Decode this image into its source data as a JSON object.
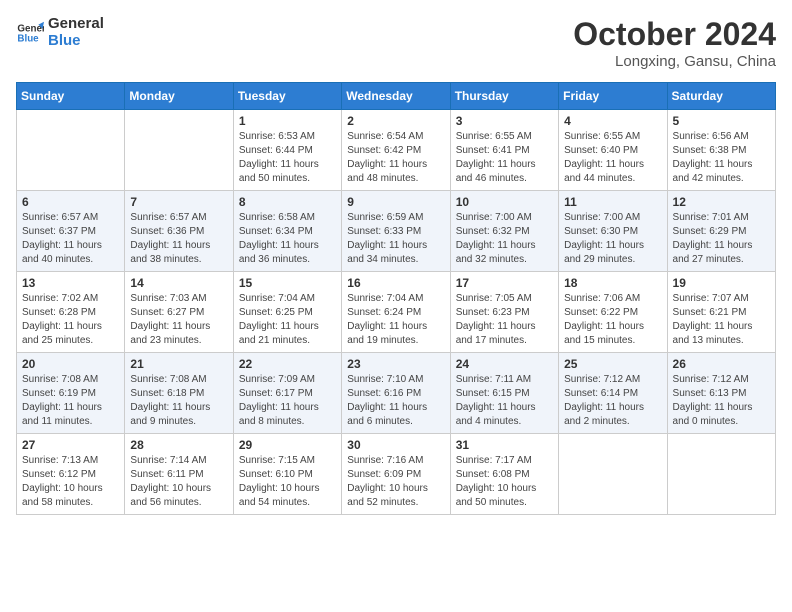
{
  "logo": {
    "line1": "General",
    "line2": "Blue"
  },
  "title": "October 2024",
  "location": "Longxing, Gansu, China",
  "days_header": [
    "Sunday",
    "Monday",
    "Tuesday",
    "Wednesday",
    "Thursday",
    "Friday",
    "Saturday"
  ],
  "weeks": [
    [
      {
        "day": "",
        "info": ""
      },
      {
        "day": "",
        "info": ""
      },
      {
        "day": "1",
        "info": "Sunrise: 6:53 AM\nSunset: 6:44 PM\nDaylight: 11 hours and 50 minutes."
      },
      {
        "day": "2",
        "info": "Sunrise: 6:54 AM\nSunset: 6:42 PM\nDaylight: 11 hours and 48 minutes."
      },
      {
        "day": "3",
        "info": "Sunrise: 6:55 AM\nSunset: 6:41 PM\nDaylight: 11 hours and 46 minutes."
      },
      {
        "day": "4",
        "info": "Sunrise: 6:55 AM\nSunset: 6:40 PM\nDaylight: 11 hours and 44 minutes."
      },
      {
        "day": "5",
        "info": "Sunrise: 6:56 AM\nSunset: 6:38 PM\nDaylight: 11 hours and 42 minutes."
      }
    ],
    [
      {
        "day": "6",
        "info": "Sunrise: 6:57 AM\nSunset: 6:37 PM\nDaylight: 11 hours and 40 minutes."
      },
      {
        "day": "7",
        "info": "Sunrise: 6:57 AM\nSunset: 6:36 PM\nDaylight: 11 hours and 38 minutes."
      },
      {
        "day": "8",
        "info": "Sunrise: 6:58 AM\nSunset: 6:34 PM\nDaylight: 11 hours and 36 minutes."
      },
      {
        "day": "9",
        "info": "Sunrise: 6:59 AM\nSunset: 6:33 PM\nDaylight: 11 hours and 34 minutes."
      },
      {
        "day": "10",
        "info": "Sunrise: 7:00 AM\nSunset: 6:32 PM\nDaylight: 11 hours and 32 minutes."
      },
      {
        "day": "11",
        "info": "Sunrise: 7:00 AM\nSunset: 6:30 PM\nDaylight: 11 hours and 29 minutes."
      },
      {
        "day": "12",
        "info": "Sunrise: 7:01 AM\nSunset: 6:29 PM\nDaylight: 11 hours and 27 minutes."
      }
    ],
    [
      {
        "day": "13",
        "info": "Sunrise: 7:02 AM\nSunset: 6:28 PM\nDaylight: 11 hours and 25 minutes."
      },
      {
        "day": "14",
        "info": "Sunrise: 7:03 AM\nSunset: 6:27 PM\nDaylight: 11 hours and 23 minutes."
      },
      {
        "day": "15",
        "info": "Sunrise: 7:04 AM\nSunset: 6:25 PM\nDaylight: 11 hours and 21 minutes."
      },
      {
        "day": "16",
        "info": "Sunrise: 7:04 AM\nSunset: 6:24 PM\nDaylight: 11 hours and 19 minutes."
      },
      {
        "day": "17",
        "info": "Sunrise: 7:05 AM\nSunset: 6:23 PM\nDaylight: 11 hours and 17 minutes."
      },
      {
        "day": "18",
        "info": "Sunrise: 7:06 AM\nSunset: 6:22 PM\nDaylight: 11 hours and 15 minutes."
      },
      {
        "day": "19",
        "info": "Sunrise: 7:07 AM\nSunset: 6:21 PM\nDaylight: 11 hours and 13 minutes."
      }
    ],
    [
      {
        "day": "20",
        "info": "Sunrise: 7:08 AM\nSunset: 6:19 PM\nDaylight: 11 hours and 11 minutes."
      },
      {
        "day": "21",
        "info": "Sunrise: 7:08 AM\nSunset: 6:18 PM\nDaylight: 11 hours and 9 minutes."
      },
      {
        "day": "22",
        "info": "Sunrise: 7:09 AM\nSunset: 6:17 PM\nDaylight: 11 hours and 8 minutes."
      },
      {
        "day": "23",
        "info": "Sunrise: 7:10 AM\nSunset: 6:16 PM\nDaylight: 11 hours and 6 minutes."
      },
      {
        "day": "24",
        "info": "Sunrise: 7:11 AM\nSunset: 6:15 PM\nDaylight: 11 hours and 4 minutes."
      },
      {
        "day": "25",
        "info": "Sunrise: 7:12 AM\nSunset: 6:14 PM\nDaylight: 11 hours and 2 minutes."
      },
      {
        "day": "26",
        "info": "Sunrise: 7:12 AM\nSunset: 6:13 PM\nDaylight: 11 hours and 0 minutes."
      }
    ],
    [
      {
        "day": "27",
        "info": "Sunrise: 7:13 AM\nSunset: 6:12 PM\nDaylight: 10 hours and 58 minutes."
      },
      {
        "day": "28",
        "info": "Sunrise: 7:14 AM\nSunset: 6:11 PM\nDaylight: 10 hours and 56 minutes."
      },
      {
        "day": "29",
        "info": "Sunrise: 7:15 AM\nSunset: 6:10 PM\nDaylight: 10 hours and 54 minutes."
      },
      {
        "day": "30",
        "info": "Sunrise: 7:16 AM\nSunset: 6:09 PM\nDaylight: 10 hours and 52 minutes."
      },
      {
        "day": "31",
        "info": "Sunrise: 7:17 AM\nSunset: 6:08 PM\nDaylight: 10 hours and 50 minutes."
      },
      {
        "day": "",
        "info": ""
      },
      {
        "day": "",
        "info": ""
      }
    ]
  ]
}
